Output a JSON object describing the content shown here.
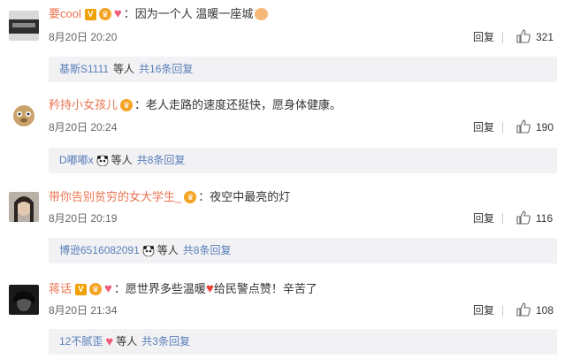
{
  "comments": [
    {
      "username": "要cool",
      "content": "：因为一个人 温暖一座城",
      "time": "8月20日 20:20",
      "reply_label": "回复",
      "likes": "321",
      "sub_reply": {
        "user": "基斯S1111",
        "middle": "等人",
        "count": "共16条回复"
      }
    },
    {
      "username": "矜持小女孩儿",
      "content": "：老人走路的速度还挺快，愿身体健康。",
      "time": "8月20日 20:24",
      "reply_label": "回复",
      "likes": "190",
      "sub_reply": {
        "user": "D嘟嘟x",
        "middle": "等人",
        "count": "共8条回复"
      }
    },
    {
      "username": "带你告别贫穷的女大学生_",
      "content": "：夜空中最亮的灯",
      "time": "8月20日 20:19",
      "reply_label": "回复",
      "likes": "116",
      "sub_reply": {
        "user": "博逊6516082091",
        "middle": "等人",
        "count": "共8条回复"
      }
    },
    {
      "username": "蒋话",
      "content_a": "：愿世界多些温暖",
      "content_b": "给民警点赞！辛苦了",
      "time": "8月20日 21:34",
      "reply_label": "回复",
      "likes": "108",
      "sub_reply": {
        "user": "12不腻歪",
        "middle": "等人",
        "count": "共3条回复"
      }
    }
  ],
  "colors": {
    "username": "#eb7350",
    "link": "#5a7fb8",
    "sub_bg": "#f2f2f5",
    "heart": "#f15c7a"
  },
  "icons": [
    "vip-v-icon",
    "crown-badge-icon",
    "heart-icon",
    "thumbs-up-icon",
    "panda-icon",
    "hands-emoji-icon"
  ]
}
